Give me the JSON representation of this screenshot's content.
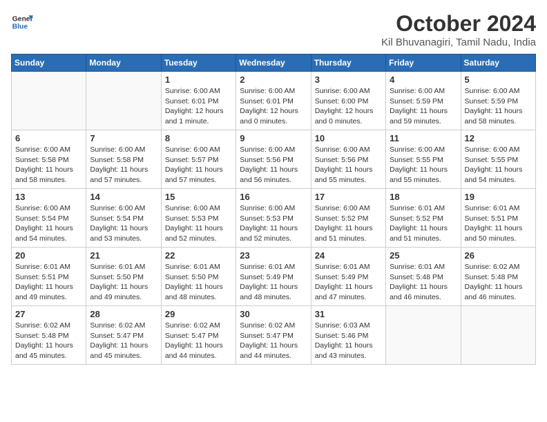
{
  "logo": {
    "line1": "General",
    "line2": "Blue"
  },
  "title": "October 2024",
  "location": "Kil Bhuvanagiri, Tamil Nadu, India",
  "weekdays": [
    "Sunday",
    "Monday",
    "Tuesday",
    "Wednesday",
    "Thursday",
    "Friday",
    "Saturday"
  ],
  "weeks": [
    [
      {
        "day": "",
        "info": ""
      },
      {
        "day": "",
        "info": ""
      },
      {
        "day": "1",
        "info": "Sunrise: 6:00 AM\nSunset: 6:01 PM\nDaylight: 12 hours\nand 1 minute."
      },
      {
        "day": "2",
        "info": "Sunrise: 6:00 AM\nSunset: 6:01 PM\nDaylight: 12 hours\nand 0 minutes."
      },
      {
        "day": "3",
        "info": "Sunrise: 6:00 AM\nSunset: 6:00 PM\nDaylight: 12 hours\nand 0 minutes."
      },
      {
        "day": "4",
        "info": "Sunrise: 6:00 AM\nSunset: 5:59 PM\nDaylight: 11 hours\nand 59 minutes."
      },
      {
        "day": "5",
        "info": "Sunrise: 6:00 AM\nSunset: 5:59 PM\nDaylight: 11 hours\nand 58 minutes."
      }
    ],
    [
      {
        "day": "6",
        "info": "Sunrise: 6:00 AM\nSunset: 5:58 PM\nDaylight: 11 hours\nand 58 minutes."
      },
      {
        "day": "7",
        "info": "Sunrise: 6:00 AM\nSunset: 5:58 PM\nDaylight: 11 hours\nand 57 minutes."
      },
      {
        "day": "8",
        "info": "Sunrise: 6:00 AM\nSunset: 5:57 PM\nDaylight: 11 hours\nand 57 minutes."
      },
      {
        "day": "9",
        "info": "Sunrise: 6:00 AM\nSunset: 5:56 PM\nDaylight: 11 hours\nand 56 minutes."
      },
      {
        "day": "10",
        "info": "Sunrise: 6:00 AM\nSunset: 5:56 PM\nDaylight: 11 hours\nand 55 minutes."
      },
      {
        "day": "11",
        "info": "Sunrise: 6:00 AM\nSunset: 5:55 PM\nDaylight: 11 hours\nand 55 minutes."
      },
      {
        "day": "12",
        "info": "Sunrise: 6:00 AM\nSunset: 5:55 PM\nDaylight: 11 hours\nand 54 minutes."
      }
    ],
    [
      {
        "day": "13",
        "info": "Sunrise: 6:00 AM\nSunset: 5:54 PM\nDaylight: 11 hours\nand 54 minutes."
      },
      {
        "day": "14",
        "info": "Sunrise: 6:00 AM\nSunset: 5:54 PM\nDaylight: 11 hours\nand 53 minutes."
      },
      {
        "day": "15",
        "info": "Sunrise: 6:00 AM\nSunset: 5:53 PM\nDaylight: 11 hours\nand 52 minutes."
      },
      {
        "day": "16",
        "info": "Sunrise: 6:00 AM\nSunset: 5:53 PM\nDaylight: 11 hours\nand 52 minutes."
      },
      {
        "day": "17",
        "info": "Sunrise: 6:00 AM\nSunset: 5:52 PM\nDaylight: 11 hours\nand 51 minutes."
      },
      {
        "day": "18",
        "info": "Sunrise: 6:01 AM\nSunset: 5:52 PM\nDaylight: 11 hours\nand 51 minutes."
      },
      {
        "day": "19",
        "info": "Sunrise: 6:01 AM\nSunset: 5:51 PM\nDaylight: 11 hours\nand 50 minutes."
      }
    ],
    [
      {
        "day": "20",
        "info": "Sunrise: 6:01 AM\nSunset: 5:51 PM\nDaylight: 11 hours\nand 49 minutes."
      },
      {
        "day": "21",
        "info": "Sunrise: 6:01 AM\nSunset: 5:50 PM\nDaylight: 11 hours\nand 49 minutes."
      },
      {
        "day": "22",
        "info": "Sunrise: 6:01 AM\nSunset: 5:50 PM\nDaylight: 11 hours\nand 48 minutes."
      },
      {
        "day": "23",
        "info": "Sunrise: 6:01 AM\nSunset: 5:49 PM\nDaylight: 11 hours\nand 48 minutes."
      },
      {
        "day": "24",
        "info": "Sunrise: 6:01 AM\nSunset: 5:49 PM\nDaylight: 11 hours\nand 47 minutes."
      },
      {
        "day": "25",
        "info": "Sunrise: 6:01 AM\nSunset: 5:48 PM\nDaylight: 11 hours\nand 46 minutes."
      },
      {
        "day": "26",
        "info": "Sunrise: 6:02 AM\nSunset: 5:48 PM\nDaylight: 11 hours\nand 46 minutes."
      }
    ],
    [
      {
        "day": "27",
        "info": "Sunrise: 6:02 AM\nSunset: 5:48 PM\nDaylight: 11 hours\nand 45 minutes."
      },
      {
        "day": "28",
        "info": "Sunrise: 6:02 AM\nSunset: 5:47 PM\nDaylight: 11 hours\nand 45 minutes."
      },
      {
        "day": "29",
        "info": "Sunrise: 6:02 AM\nSunset: 5:47 PM\nDaylight: 11 hours\nand 44 minutes."
      },
      {
        "day": "30",
        "info": "Sunrise: 6:02 AM\nSunset: 5:47 PM\nDaylight: 11 hours\nand 44 minutes."
      },
      {
        "day": "31",
        "info": "Sunrise: 6:03 AM\nSunset: 5:46 PM\nDaylight: 11 hours\nand 43 minutes."
      },
      {
        "day": "",
        "info": ""
      },
      {
        "day": "",
        "info": ""
      }
    ]
  ]
}
